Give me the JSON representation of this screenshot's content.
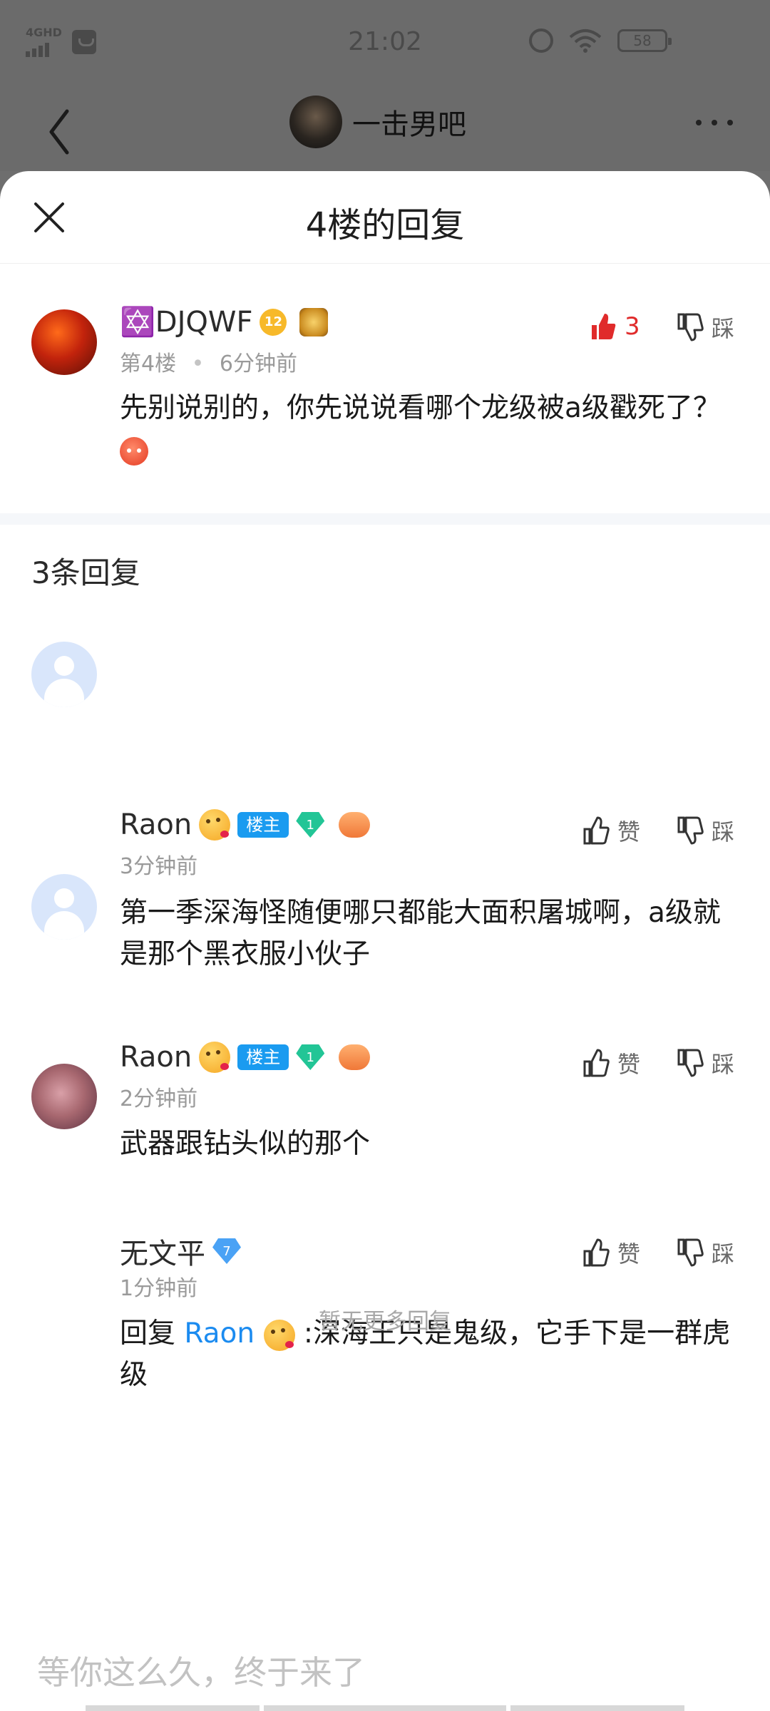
{
  "status_bar": {
    "network": "4GHD",
    "time": "21:02",
    "battery": "58"
  },
  "nav": {
    "forum_name": "一击男吧"
  },
  "sheet": {
    "title": "4楼的回复"
  },
  "main_post": {
    "username": "✡️DJQWF",
    "level": "12",
    "floor": "第4楼",
    "time": "6分钟前",
    "text": "先别说别的，你先说说看哪个龙级被a级戳死了？",
    "like_count": "3",
    "dislike_label": "踩"
  },
  "replies_header": "3条回复",
  "replies": [
    {
      "username": "Raon",
      "host_badge": "楼主",
      "level": "1",
      "time": "3分钟前",
      "text": "第一季深海怪随便哪只都能大面积屠城啊，a级就是那个黑衣服小伙子",
      "like_label": "赞",
      "dislike_label": "踩"
    },
    {
      "username": "Raon",
      "host_badge": "楼主",
      "level": "1",
      "time": "2分钟前",
      "text": "武器跟钻头似的那个",
      "like_label": "赞",
      "dislike_label": "踩"
    },
    {
      "username": "无文平",
      "level": "7",
      "time": "1分钟前",
      "reply_prefix": "回复 ",
      "mention": "Raon",
      "text": " :深海王只是鬼级，它手下是一群虎级",
      "like_label": "赞",
      "dislike_label": "踩"
    }
  ],
  "no_more": "暂无更多回复",
  "input": {
    "placeholder": "等你这么久，终于来了"
  },
  "colors": {
    "accent_blue": "#1a9bf0",
    "like_red": "#e02b2b",
    "overlay_gray": "#6b6b6b"
  }
}
